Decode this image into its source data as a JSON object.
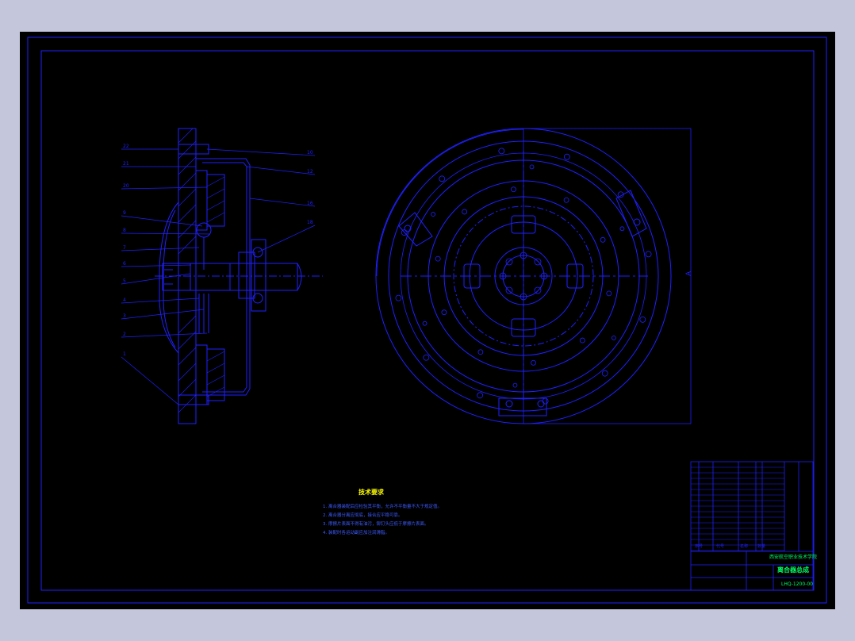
{
  "colors": {
    "background": "#c4c6dc",
    "canvas": "#000000",
    "line": "#2020ff",
    "note_text": "#3d5bff",
    "note_title": "#ffff00",
    "titleblock_highlight": "#00ff66"
  },
  "section_view": {
    "callouts_left": [
      "22",
      "21",
      "20",
      "9",
      "8",
      "7",
      "6",
      "5",
      "4",
      "3",
      "2",
      "1"
    ],
    "callouts_right": [
      "10",
      "12",
      "16",
      "18"
    ]
  },
  "front_view": {
    "side_mark": "A"
  },
  "notes": {
    "title": "技术要求",
    "items": [
      "1. 离合器装配后应检验其平衡，允许不平衡量不大于规定值。",
      "2. 离合器分离应彻底，接合应平稳可靠。",
      "3. 摩擦片表面不得有油污，铆钉头应低于摩擦片表面。",
      "4. 装配时各运动副应加注润滑脂。"
    ]
  },
  "title_block": {
    "school": "西安航空职业技术学院",
    "drawing_name": "离合器总成",
    "drawing_no": "LHQ-1200-00",
    "header_seq": "序号",
    "header_code": "代号",
    "header_name": "名称",
    "header_qty": "数量"
  },
  "icons": {
    "section_view": "clutch-section-drawing",
    "front_view": "clutch-disc-front-drawing"
  }
}
